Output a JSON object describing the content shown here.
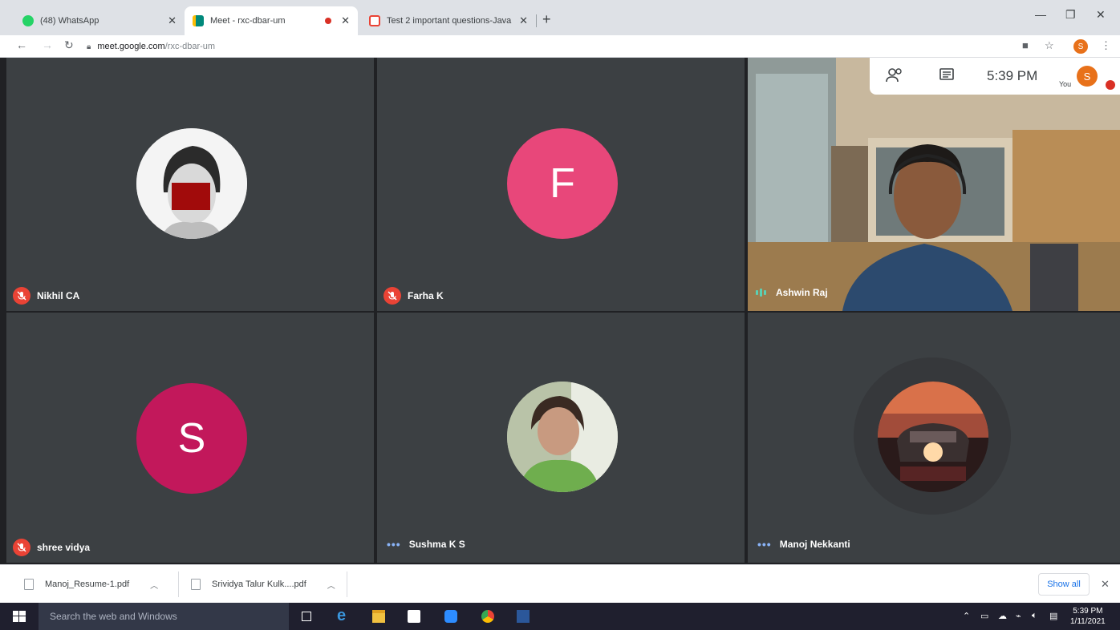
{
  "browser": {
    "tabs": [
      {
        "title": "(48) WhatsApp",
        "favicon_color": "#25d366"
      },
      {
        "title": "Meet - rxc-dbar-um",
        "favicon_color": "#00897b"
      },
      {
        "title": "Test 2 important questions-Java",
        "favicon_color": "#ea4335"
      }
    ],
    "url_host": "meet.google.com",
    "url_path": "/rxc-dbar-um",
    "profile_initial": "S"
  },
  "meet": {
    "time": "5:39 PM",
    "you_label": "You",
    "self_initial": "S",
    "participants": [
      {
        "name": "Nikhil CA",
        "status": "muted"
      },
      {
        "name": "Farha K",
        "status": "muted",
        "initial": "F",
        "color": "#e8477a"
      },
      {
        "name": "Ashwin Raj",
        "status": "speaking"
      },
      {
        "name": "shree vidya",
        "status": "muted",
        "initial": "S",
        "color": "#c2185b"
      },
      {
        "name": "Sushma K S",
        "status": "idle"
      },
      {
        "name": "Manoj Nekkanti",
        "status": "idle"
      }
    ]
  },
  "downloads": {
    "items": [
      "Manoj_Resume-1.pdf",
      "Srividya Talur Kulk....pdf"
    ],
    "show_all": "Show all"
  },
  "taskbar": {
    "search_placeholder": "Search the web and Windows",
    "time": "5:39 PM",
    "date": "1/11/2021"
  }
}
